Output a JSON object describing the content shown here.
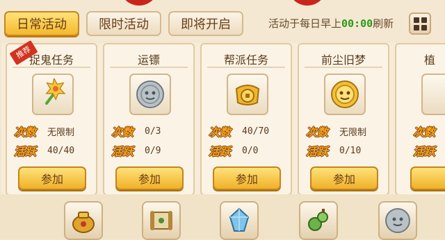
{
  "tabs": [
    {
      "label": "日常活动",
      "active": true
    },
    {
      "label": "限时活动",
      "active": false
    },
    {
      "label": "即将开启",
      "active": false
    }
  ],
  "refresh": {
    "prefix": "活动于每日早上",
    "time": "00:00",
    "suffix": "刷新"
  },
  "menu_icon": "grid-icon",
  "stat_labels": {
    "count": "次数",
    "activity": "活跃"
  },
  "cards": [
    {
      "title": "捉鬼任务",
      "badge": "推荐",
      "icon": "flower-wand-icon",
      "count": "无限制",
      "activity": "40/40",
      "button": "参加"
    },
    {
      "title": "运镖",
      "badge": "",
      "icon": "silver-coin-icon",
      "count": "0/3",
      "activity": "0/9",
      "button": "参加"
    },
    {
      "title": "帮派任务",
      "badge": "",
      "icon": "gold-coin-icon",
      "count": "40/70",
      "activity": "0/0",
      "button": "参加"
    },
    {
      "title": "前尘旧梦",
      "badge": "",
      "icon": "gold-medal-icon",
      "count": "无限制",
      "activity": "0/10",
      "button": "参加"
    },
    {
      "title": "植",
      "badge": "",
      "icon": "",
      "count": "",
      "activity": "",
      "button": ""
    }
  ],
  "bottom_icons": [
    "golden-pot-icon",
    "scroll-icon",
    "blue-crystal-icon",
    "green-gourd-icon",
    "silver-coin-icon"
  ],
  "colors": {
    "accent_gold": "#f3b92c",
    "stat_orange": "#f7a21a",
    "time_green": "#2b9a16",
    "badge_red": "#d3321f"
  }
}
